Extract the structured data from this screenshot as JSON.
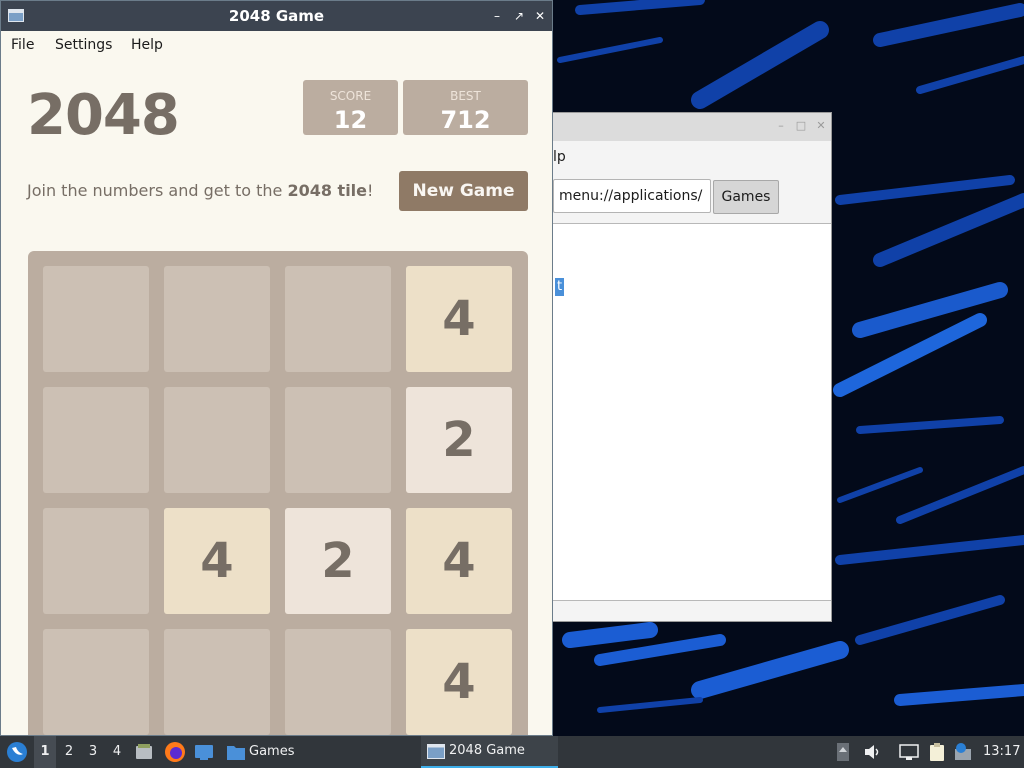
{
  "game_window": {
    "title": "2048 Game",
    "menu": [
      "File",
      "Settings",
      "Help"
    ],
    "heading": "2048",
    "score_label": "SCORE",
    "score_value": "12",
    "best_label": "BEST",
    "best_value": "712",
    "intro_prefix": "Join the numbers and get to the ",
    "intro_bold": "2048 tile",
    "intro_suffix": "!",
    "new_game_label": "New Game",
    "board": [
      [
        0,
        0,
        0,
        4
      ],
      [
        0,
        0,
        0,
        2
      ],
      [
        0,
        4,
        2,
        4
      ],
      [
        0,
        0,
        0,
        4
      ]
    ]
  },
  "file_manager": {
    "menu_fragment": "lp",
    "path": "menu://applications/",
    "games_button": "Games",
    "selected_fragment": "t"
  },
  "taskbar": {
    "workspaces": [
      "1",
      "2",
      "3",
      "4"
    ],
    "active_workspace": "1",
    "tasks": [
      "Games",
      "2048 Game"
    ],
    "clock": "13:17"
  },
  "colors": {
    "tile_2": "#eee4da",
    "tile_4": "#ede0c8",
    "board": "#bbada0",
    "new_game_button": "#8f7a66"
  }
}
